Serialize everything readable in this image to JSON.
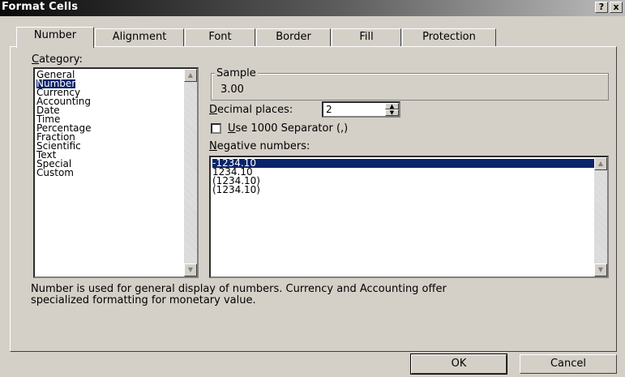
{
  "window": {
    "title": "Format Cells",
    "help_glyph": "?",
    "close_glyph": "x"
  },
  "tabs": [
    "Number",
    "Alignment",
    "Font",
    "Border",
    "Fill",
    "Protection"
  ],
  "category": {
    "label_underlined": "C",
    "label_rest": "ategory:",
    "items": [
      "General",
      "Number",
      "Currency",
      "Accounting",
      "Date",
      "Time",
      "Percentage",
      "Fraction",
      "Scientific",
      "Text",
      "Special",
      "Custom"
    ],
    "selected": "Number"
  },
  "sample": {
    "label": "Sample",
    "value": "3.00"
  },
  "decimal_places": {
    "label_underlined": "D",
    "label_rest": "ecimal places:",
    "value": "2"
  },
  "separator": {
    "label_underlined": "U",
    "label_rest": "se 1000 Separator (,)",
    "checked": false
  },
  "negative_numbers": {
    "label_underlined": "N",
    "label_rest": "egative numbers:",
    "items": [
      "-1234.10",
      "1234.10",
      "(1234.10)",
      "(1234.10)"
    ],
    "selected": "-1234.10"
  },
  "description": [
    "Number is used for general display of numbers.  Currency and Accounting offer",
    "specialized formatting for monetary value."
  ],
  "buttons": {
    "ok": "OK",
    "cancel": "Cancel"
  }
}
